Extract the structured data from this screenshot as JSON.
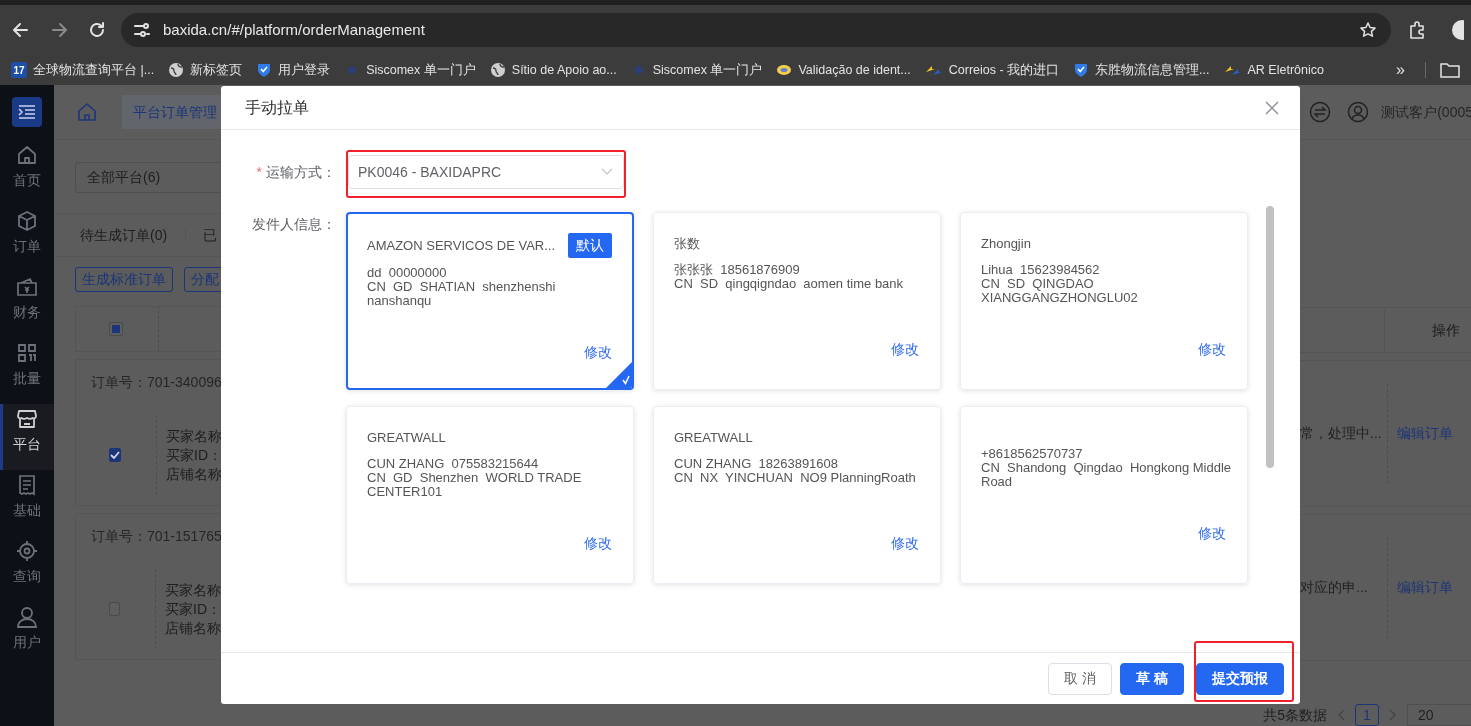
{
  "browser": {
    "url": "baxida.cn/#/platform/orderManagement",
    "more": "»",
    "bookmarks": [
      {
        "kind": "badge",
        "icon_text": "17",
        "label": "全球物流查询平台 |..."
      },
      {
        "kind": "globe",
        "label": "新标签页"
      },
      {
        "kind": "shield",
        "label": "用户登录"
      },
      {
        "kind": "diamond",
        "label": "Siscomex 单一门户"
      },
      {
        "kind": "globe",
        "label": "Sítio de Apoio ao..."
      },
      {
        "kind": "diamond",
        "label": "Siscomex 单一门户"
      },
      {
        "kind": "coin",
        "label": "Validação de ident..."
      },
      {
        "kind": "arrows",
        "label": "Correios - 我的进口"
      },
      {
        "kind": "shield",
        "label": "东胜物流信息管理..."
      },
      {
        "kind": "arrows",
        "label": "AR Eletrônico"
      }
    ]
  },
  "sidebar": {
    "items": [
      {
        "kind": "home",
        "label": "首页",
        "selected": false
      },
      {
        "kind": "box",
        "label": "订单",
        "selected": false
      },
      {
        "kind": "wallet",
        "label": "财务",
        "selected": false
      },
      {
        "kind": "grid",
        "label": "批量",
        "selected": false
      },
      {
        "kind": "store",
        "label": "平台",
        "selected": true
      },
      {
        "kind": "receipt",
        "label": "基础",
        "selected": false
      },
      {
        "kind": "target",
        "label": "查询",
        "selected": false
      },
      {
        "kind": "user",
        "label": "用户",
        "selected": false
      }
    ]
  },
  "header": {
    "breadcrumb": "平台订单管理",
    "user": "测试客户(0005"
  },
  "filters": {
    "platform": "全部平台(6)",
    "status_tabs": [
      "待生成订单(0)",
      "已"
    ],
    "actions": [
      "生成标准订单",
      "分配"
    ]
  },
  "table": {
    "header_indeterminate": true,
    "action_column": "操作",
    "orders": [
      {
        "order_no": "订单号：701-340096",
        "checked": true,
        "fields": [
          "买家名称",
          "买家ID：",
          "店铺名称"
        ],
        "status": "常，处理中...",
        "action": "编辑订单"
      },
      {
        "order_no": "订单号：701-151765",
        "checked": false,
        "fields": [
          "买家名称",
          "买家ID：",
          "店铺名称"
        ],
        "status": "对应的申...",
        "action": "编辑订单"
      }
    ]
  },
  "pagination": {
    "total": "共5条数据",
    "page": "1",
    "page_size": "20"
  },
  "modal": {
    "title": "手动拉单",
    "shipping": {
      "required_mark": "*",
      "label": "运输方式：",
      "value": "PK0046 - BAXIDAPRC",
      "highlighted": true
    },
    "sender_label": "发件人信息：",
    "senders": [
      {
        "name": "AMAZON SERVICOS DE VAR...",
        "badge": "默认",
        "lines": [
          "dd  00000000",
          "CN  GD  SHATIAN  shenzhenshi nanshanqu"
        ],
        "edit": "修改",
        "selected": true
      },
      {
        "name": "张数",
        "lines": [
          "张张张  18561876909",
          "CN  SD  qingqigndao  aomen time bank"
        ],
        "edit": "修改",
        "selected": false
      },
      {
        "name": "Zhongjin",
        "lines": [
          "Lihua  15623984562",
          "CN  SD  QINGDAO XIANGGANGZHONGLU02"
        ],
        "edit": "修改",
        "selected": false
      },
      {
        "name": "GREATWALL",
        "lines": [
          "CUN ZHANG  075583215644",
          "CN  GD  Shenzhen  WORLD TRADE CENTER101"
        ],
        "edit": "修改",
        "selected": false
      },
      {
        "name": "GREATWALL",
        "lines": [
          "CUN ZHANG  18263891608",
          "CN  NX  YINCHUAN  NO9 PlanningRoath"
        ],
        "edit": "修改",
        "selected": false
      },
      {
        "lines": [
          "+8618562570737",
          "CN  Shandong  Qingdao  Hongkong Middle Road"
        ],
        "edit": "修改",
        "selected": false
      }
    ],
    "footer_buttons": [
      {
        "label": "取 消",
        "kind": "default",
        "highlighted": false
      },
      {
        "label": "草 稿",
        "kind": "primary",
        "highlighted": false
      },
      {
        "label": "提交预报",
        "kind": "primary",
        "highlighted": true
      }
    ]
  }
}
